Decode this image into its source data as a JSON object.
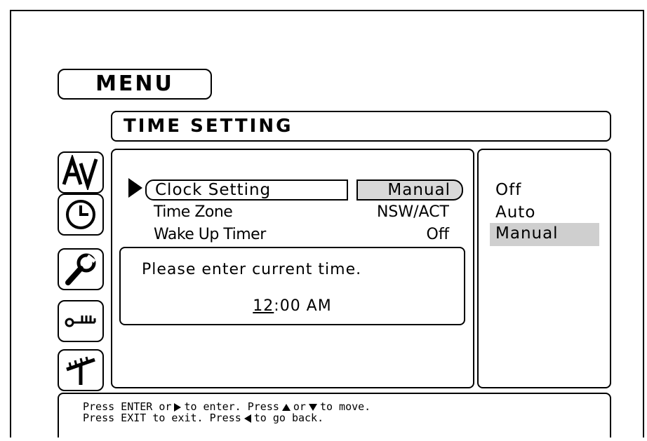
{
  "header": {
    "menu_label": "MENU",
    "title": "TIME SETTING"
  },
  "side_icons": [
    "av-icon",
    "clock-icon",
    "wrench-icon",
    "key-icon",
    "antenna-icon"
  ],
  "main": {
    "rows": [
      {
        "label": "Clock Setting",
        "value": "Manual",
        "selected": true
      },
      {
        "label": "Time Zone",
        "value": "NSW/ACT"
      },
      {
        "label": "Wake Up Timer",
        "value": "Off"
      }
    ],
    "prompt": {
      "message": "Please enter current time.",
      "hour": "12",
      "rest": ":00 AM"
    }
  },
  "options": {
    "items": [
      "Off",
      "Auto",
      "Manual"
    ],
    "highlighted": "Manual",
    "highlight_color": "#cfcfcf"
  },
  "help": {
    "l1_a": "Press ENTER or",
    "l1_b": "to enter. Press",
    "l1_c": "or",
    "l1_d": "to move.",
    "l2_a": "Press EXIT to exit. Press",
    "l2_b": "to go back."
  }
}
